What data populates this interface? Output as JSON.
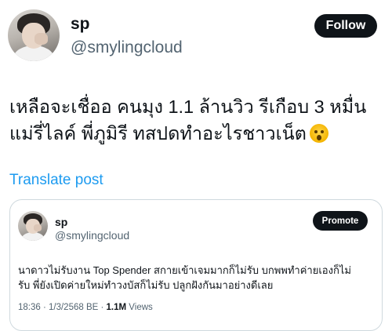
{
  "author": {
    "display_name": "sp",
    "handle": "@smylingcloud",
    "follow_label": "Follow"
  },
  "post": {
    "line1": "เหลือจะเชื่ออ คนมุง 1.1 ล้านวิว รีเกือบ 3 หมื่น",
    "line2": "แม่รี่ไลค์ พี่ภูมิรี ทสปดทำอะไรชาวเน็ต",
    "emoji_icon": "fearful-face-emoji",
    "translate_label": "Translate post"
  },
  "quoted_post": {
    "display_name": "sp",
    "handle": "@smylingcloud",
    "promote_label": "Promote",
    "line1": "นาดาวไม่รับงาน Top Spender สกายเข้าเจมมากก็ไม่รับ บกพพทำค่ายเองก็ไม่",
    "line2": "รับ พี่ยังเปิดค่ายใหม่ทำวงบัสก็ไม่รับ ปลูกฝังกันมาอย่างดีเลย",
    "timestamp": "18:36 · 1/3/2568 BE · ",
    "views_count": "1.1M",
    "views_label": " Views"
  }
}
